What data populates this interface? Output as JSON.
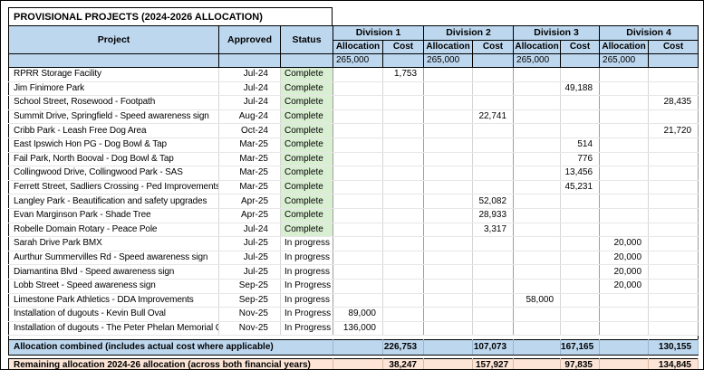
{
  "title": "PROVISIONAL PROJECTS  (2024-2026 ALLOCATION)",
  "columns": {
    "project": "Project",
    "approved": "Approved",
    "status": "Status",
    "divisions": [
      "Division 1",
      "Division 2",
      "Division 3",
      "Division 4"
    ],
    "allocation": "Allocation",
    "cost": "Cost"
  },
  "budget_row": [
    "265,000",
    "",
    "265,000",
    "",
    "265,000",
    "",
    "265,000",
    ""
  ],
  "rows": [
    {
      "project": "RPRR Storage Facility",
      "approved": "Jul-24",
      "status": "Complete",
      "values": [
        "",
        "1,753",
        "",
        "",
        "",
        "",
        "",
        ""
      ]
    },
    {
      "project": "Jim Finimore Park",
      "approved": "Jul-24",
      "status": "Complete",
      "values": [
        "",
        "",
        "",
        "",
        "",
        "49,188",
        "",
        ""
      ]
    },
    {
      "project": "School Street, Rosewood - Footpath",
      "approved": "Jul-24",
      "status": "Complete",
      "values": [
        "",
        "",
        "",
        "",
        "",
        "",
        "",
        "28,435"
      ]
    },
    {
      "project": "Summit Drive, Springfield - Speed awareness sign",
      "approved": "Aug-24",
      "status": "Complete",
      "values": [
        "",
        "",
        "",
        "22,741",
        "",
        "",
        "",
        ""
      ]
    },
    {
      "project": "Cribb Park - Leash Free Dog Area",
      "approved": "Oct-24",
      "status": "Complete",
      "values": [
        "",
        "",
        "",
        "",
        "",
        "",
        "",
        "21,720"
      ]
    },
    {
      "project": "East Ipswich Hon PG - Dog Bowl & Tap",
      "approved": "Mar-25",
      "status": "Complete",
      "values": [
        "",
        "",
        "",
        "",
        "",
        "514",
        "",
        ""
      ]
    },
    {
      "project": "Fail Park, North Booval - Dog Bowl & Tap",
      "approved": "Mar-25",
      "status": "Complete",
      "values": [
        "",
        "",
        "",
        "",
        "",
        "776",
        "",
        ""
      ]
    },
    {
      "project": "Collingwood Drive, Collingwood Park - SAS",
      "approved": "Mar-25",
      "status": "Complete",
      "values": [
        "",
        "",
        "",
        "",
        "",
        "13,456",
        "",
        ""
      ]
    },
    {
      "project": "Ferrett Street, Sadliers Crossing - Ped Improvements",
      "approved": "Mar-25",
      "status": "Complete",
      "values": [
        "",
        "",
        "",
        "",
        "",
        "45,231",
        "",
        ""
      ]
    },
    {
      "project": "Langley Park - Beautification and safety upgrades",
      "approved": "Apr-25",
      "status": "Complete",
      "values": [
        "",
        "",
        "",
        "52,082",
        "",
        "",
        "",
        ""
      ]
    },
    {
      "project": "Evan Marginson Park - Shade Tree",
      "approved": "Apr-25",
      "status": "Complete",
      "values": [
        "",
        "",
        "",
        "28,933",
        "",
        "",
        "",
        ""
      ]
    },
    {
      "project": "Robelle Domain Rotary - Peace Pole",
      "approved": "Jul-24",
      "status": "Complete",
      "values": [
        "",
        "",
        "",
        "3,317",
        "",
        "",
        "",
        ""
      ]
    },
    {
      "project": "Sarah Drive Park BMX",
      "approved": "Jul-25",
      "status": "In progress",
      "values": [
        "",
        "",
        "",
        "",
        "",
        "",
        "20,000",
        ""
      ]
    },
    {
      "project": "Aurthur Summervilles Rd - Speed awareness sign",
      "approved": "Jul-25",
      "status": "In progress",
      "values": [
        "",
        "",
        "",
        "",
        "",
        "",
        "20,000",
        ""
      ]
    },
    {
      "project": "Diamantina Blvd - Speed awareness sign",
      "approved": "Jul-25",
      "status": "In progress",
      "values": [
        "",
        "",
        "",
        "",
        "",
        "",
        "20,000",
        ""
      ]
    },
    {
      "project": "Lobb Street - Speed awareness sign",
      "approved": "Sep-25",
      "status": "In Progress",
      "values": [
        "",
        "",
        "",
        "",
        "",
        "",
        "20,000",
        ""
      ]
    },
    {
      "project": "Limestone Park Athletics - DDA Improvements",
      "approved": "Sep-25",
      "status": "In progress",
      "values": [
        "",
        "",
        "",
        "",
        "58,000",
        "",
        "",
        ""
      ]
    },
    {
      "project": "Installation of dugouts - Kevin Bull Oval",
      "approved": "Nov-25",
      "status": "In Progress",
      "values": [
        "89,000",
        "",
        "",
        "",
        "",
        "",
        "",
        ""
      ]
    },
    {
      "project": "Installation of dugouts - The Peter Phelan Memorial Oval",
      "approved": "Nov-25",
      "status": "In Progress",
      "values": [
        "136,000",
        "",
        "",
        "",
        "",
        "",
        "",
        ""
      ]
    }
  ],
  "footer": {
    "combined_label": "Allocation combined (includes actual cost where applicable)",
    "combined": [
      "",
      "226,753",
      "",
      "107,073",
      "",
      "167,165",
      "",
      "130,155"
    ],
    "remaining_label": "Remaining allocation 2024-26 allocation (across both financial years)",
    "remaining": [
      "",
      "38,247",
      "",
      "157,927",
      "",
      "97,835",
      "",
      "134,845"
    ]
  },
  "colors": {
    "header_bg": "#BDD7EE",
    "complete_bg": "#D9EFD2",
    "remaining_bg": "#FCE4D6",
    "border": "#000000"
  }
}
